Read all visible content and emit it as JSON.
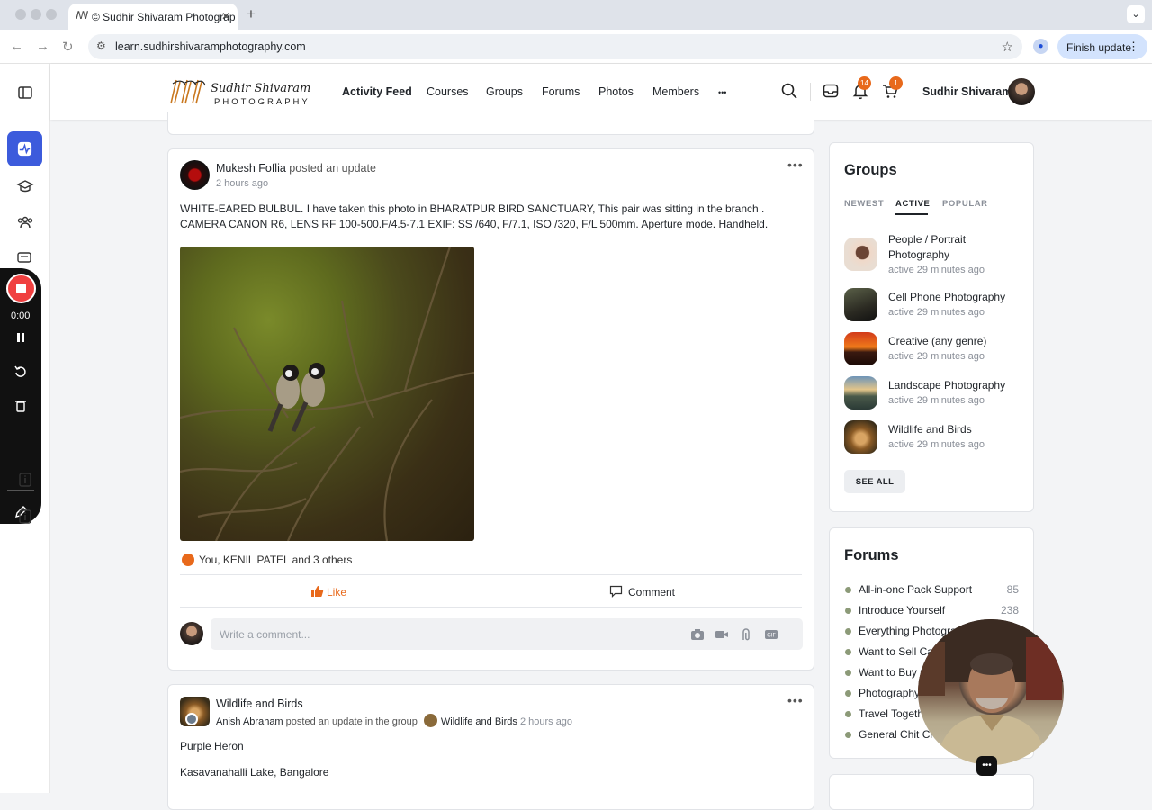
{
  "browser": {
    "tab_title": "© Sudhir Shivaram Photograp",
    "url": "learn.sudhirshivaramphotography.com",
    "finish_update": "Finish update"
  },
  "site": {
    "logo_line1": "Sudhir Shivaram",
    "logo_line2": "PHOTOGRAPHY",
    "nav": [
      "Activity Feed",
      "Courses",
      "Groups",
      "Forums",
      "Photos",
      "Members",
      "•••"
    ],
    "notifications_count": "14",
    "cart_count": "1",
    "user_name": "Sudhir Shivaram"
  },
  "recorder": {
    "time": "0:00"
  },
  "post1": {
    "author": "Mukesh Foflia",
    "action": " posted an update",
    "time": "2 hours ago",
    "text": "WHITE-EARED BULBUL. I have taken this photo in BHARATPUR BIRD SANCTUARY, This pair was sitting in the branch . CAMERA CANON R6, LENS RF 100-500.F/4.5-7.1 EXIF: SS /640, F/7.1, ISO /320, F/L 500mm. Aperture mode. Handheld.",
    "reactions": "You, KENIL PATEL and 3 others",
    "like_label": "Like",
    "comment_label": "Comment",
    "comment_placeholder": "Write a comment..."
  },
  "post2": {
    "group": "Wildlife and Birds",
    "author": "Anish Abraham",
    "action": " posted an update in the group ",
    "group_ref": "Wildlife and Birds",
    "time": " 2 hours ago",
    "line1": "Purple Heron",
    "line2": "Kasavanahalli Lake, Bangalore"
  },
  "groups_widget": {
    "title": "Groups",
    "tabs": [
      "NEWEST",
      "ACTIVE",
      "POPULAR"
    ],
    "items": [
      {
        "name": "People / Portrait Photography",
        "meta": "active 29 minutes ago"
      },
      {
        "name": "Cell Phone Photography",
        "meta": "active 29 minutes ago"
      },
      {
        "name": "Creative (any genre)",
        "meta": "active 29 minutes ago"
      },
      {
        "name": "Landscape Photography",
        "meta": "active 29 minutes ago"
      },
      {
        "name": "Wildlife and Birds",
        "meta": "active 29 minutes ago"
      }
    ],
    "see_all": "SEE ALL"
  },
  "forums_widget": {
    "title": "Forums",
    "items": [
      {
        "name": "All-in-one Pack Support",
        "count": "85"
      },
      {
        "name": "Introduce Yourself",
        "count": "238"
      },
      {
        "name": "Everything Photogra",
        "count": ""
      },
      {
        "name": "Want to Sell Ca",
        "count": ""
      },
      {
        "name": "Want to Buy G",
        "count": ""
      },
      {
        "name": "Photography",
        "count": ""
      },
      {
        "name": "Travel Togeth",
        "count": ""
      },
      {
        "name": "General Chit Ch",
        "count": ""
      }
    ]
  },
  "colors": {
    "accent": "#3c5bdc",
    "orange": "#e8691b"
  }
}
